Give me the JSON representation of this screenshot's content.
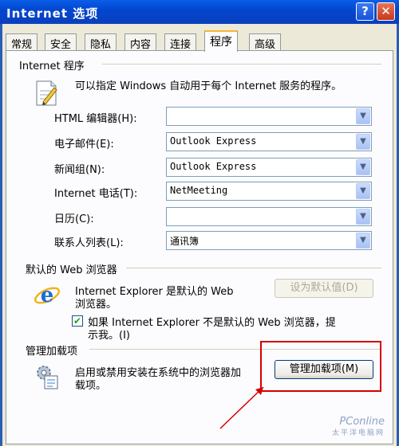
{
  "window": {
    "title": "Internet 选项",
    "help_label": "?",
    "close_label": "✕"
  },
  "tabs": [
    "常规",
    "安全",
    "隐私",
    "内容",
    "连接",
    "程序",
    "高级"
  ],
  "active_tab": "程序",
  "internet_programs": {
    "group_title": "Internet 程序",
    "description": "可以指定 Windows 自动用于每个 Internet 服务的程序。",
    "rows": [
      {
        "label": "HTML 编辑器(H):",
        "value": ""
      },
      {
        "label": "电子邮件(E):",
        "value": "Outlook Express"
      },
      {
        "label": "新闻组(N):",
        "value": "Outlook Express"
      },
      {
        "label": "Internet 电话(T):",
        "value": "NetMeeting"
      },
      {
        "label": "日历(C):",
        "value": ""
      },
      {
        "label": "联系人列表(L):",
        "value": "通讯簿"
      }
    ]
  },
  "default_browser": {
    "group_title": "默认的 Web 浏览器",
    "status_line1": "Internet Explorer 是默认的 Web",
    "status_line2": "浏览器。",
    "set_default_label": "设为默认值(D)",
    "check_line1": "如果 Internet Explorer 不是默认的 Web 浏览器，提",
    "check_line2": "示我。(I)",
    "checked": true
  },
  "addons": {
    "group_title": "管理加载项",
    "desc_line1": "启用或禁用安装在系统中的浏览器加",
    "desc_line2": "载项。",
    "manage_label": "管理加载项(M)"
  },
  "watermark": {
    "brand": "PConline",
    "sub": "太平洋电脑网"
  },
  "colors": {
    "title_bar": "#0346d1",
    "tab_highlight": "#f8b534",
    "annotation": "#d40000"
  }
}
